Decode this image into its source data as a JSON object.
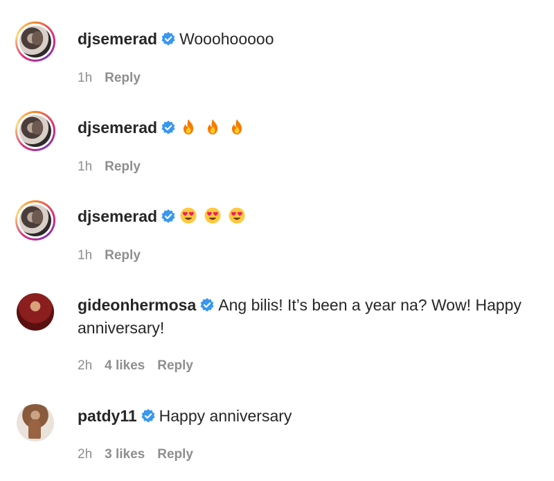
{
  "comments": [
    {
      "username": "djsemerad",
      "verified": true,
      "text": "Wooohooooo",
      "time": "1h",
      "reply": "Reply",
      "avatar": "story-ring"
    },
    {
      "username": "djsemerad",
      "verified": true,
      "emoji": [
        "fire-emoji",
        "fire-emoji",
        "fire-emoji"
      ],
      "time": "1h",
      "reply": "Reply",
      "avatar": "story-ring"
    },
    {
      "username": "djsemerad",
      "verified": true,
      "emoji": [
        "heart-eyes-emoji",
        "heart-eyes-emoji",
        "heart-eyes-emoji"
      ],
      "time": "1h",
      "reply": "Reply",
      "avatar": "story-ring"
    },
    {
      "username": "gideonhermosa",
      "verified": true,
      "text": "Ang bilis! It’s been a year na? Wow! Happy anniversary!",
      "time": "2h",
      "likes": "4 likes",
      "reply": "Reply"
    },
    {
      "username": "patdy11",
      "verified": true,
      "text": "Happy anniversary",
      "time": "2h",
      "likes": "3 likes",
      "reply": "Reply"
    }
  ],
  "colors": {
    "verified": "#3897f0",
    "meta": "#8e8e8e",
    "text": "#262626"
  }
}
